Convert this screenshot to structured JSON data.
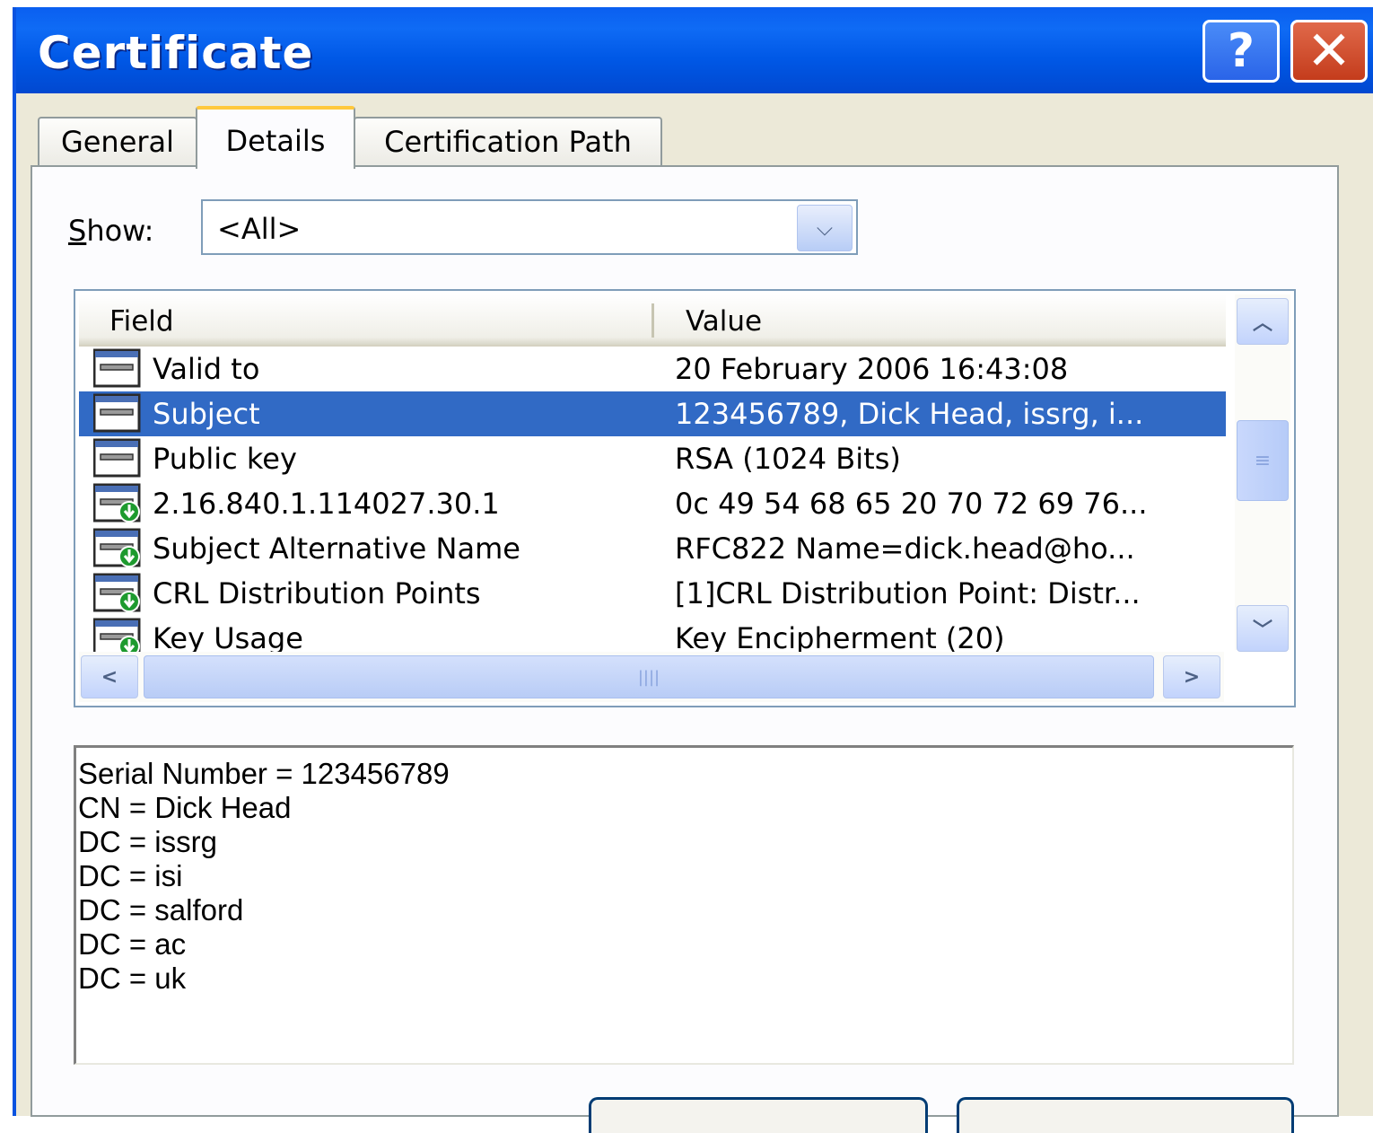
{
  "window": {
    "title": "Certificate",
    "help_label": "?",
    "close_label": "✕"
  },
  "tabs": [
    {
      "label": "General"
    },
    {
      "label": "Details"
    },
    {
      "label": "Certification Path"
    }
  ],
  "show": {
    "label_prefix": "S",
    "label_rest": "how:",
    "value": "<All>"
  },
  "list": {
    "columns": {
      "field": "Field",
      "value": "Value"
    },
    "rows": [
      {
        "field": "Valid to",
        "value": "20 February 2006 16:43:08",
        "icon": "certificate-field-icon"
      },
      {
        "field": "Subject",
        "value": "123456789, Dick Head, issrg, i...",
        "icon": "certificate-field-icon",
        "selected": true
      },
      {
        "field": "Public key",
        "value": "RSA (1024 Bits)",
        "icon": "certificate-field-icon"
      },
      {
        "field": "2.16.840.1.114027.30.1",
        "value": "0c 49 54 68 65 20 70 72 69 76...",
        "icon": "certificate-extension-icon"
      },
      {
        "field": "Subject Alternative Name",
        "value": "RFC822 Name=dick.head@ho...",
        "icon": "certificate-extension-icon"
      },
      {
        "field": "CRL Distribution Points",
        "value": "[1]CRL Distribution Point: Distr...",
        "icon": "certificate-extension-icon"
      },
      {
        "field": "Key Usage",
        "value": "Key Encipherment (20)",
        "icon": "certificate-extension-icon"
      }
    ]
  },
  "detail": {
    "lines": [
      "Serial Number = 123456789",
      "CN = Dick Head",
      "DC = issrg",
      "DC = isi",
      "DC = salford",
      "DC = ac",
      "DC = uk"
    ]
  },
  "colors": {
    "titlebar": "#0058e6",
    "selection": "#316ac5",
    "dialog_bg": "#ece9d8"
  }
}
